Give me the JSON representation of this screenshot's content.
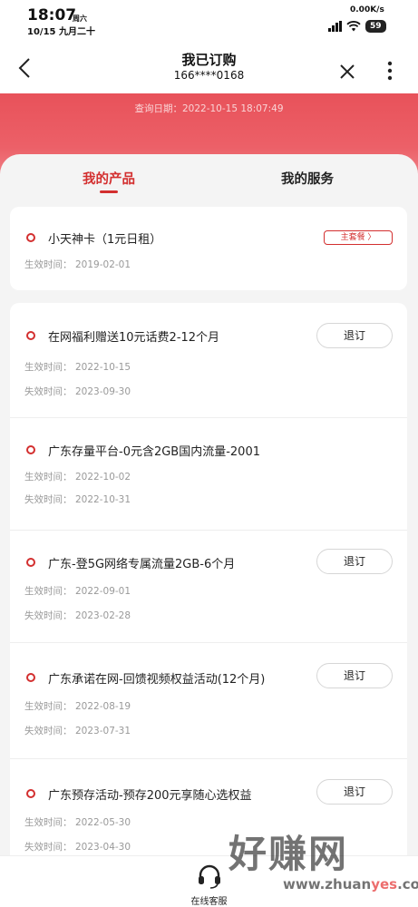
{
  "status_bar": {
    "time": "18:07",
    "weekday": "周六",
    "date": "10/15 九月二十",
    "net_speed": "0.00K/s",
    "battery": "59"
  },
  "header": {
    "title": "我已订购",
    "phone": "166****0168"
  },
  "banner": {
    "query_date": "查询日期：2022-10-15 18:07:49"
  },
  "tabs": {
    "products": "我的产品",
    "services": "我的服务"
  },
  "main_package": {
    "name": "小天神卡（1元日租）",
    "badge": "主套餐 〉",
    "effective_label": "生效时间：",
    "effective": "2019-02-01"
  },
  "labels": {
    "effective": "生效时间：",
    "expire": "失效时间：",
    "unsubscribe": "退订"
  },
  "products": [
    {
      "name": "在网福利赠送10元话费2-12个月",
      "effective": "2022-10-15",
      "expire": "2023-09-30",
      "unsubscribe": "退订"
    },
    {
      "name": "广东存量平台-0元含2GB国内流量-2001",
      "effective": "2022-10-02",
      "expire": "2022-10-31",
      "unsubscribe": ""
    },
    {
      "name": "广东-登5G网络专属流量2GB-6个月",
      "effective": "2022-09-01",
      "expire": "2023-02-28",
      "unsubscribe": "退订"
    },
    {
      "name": "广东承诺在网-回馈视频权益活动(12个月)",
      "effective": "2022-08-19",
      "expire": "2023-07-31",
      "unsubscribe": "退订"
    },
    {
      "name": "广东预存活动-预存200元享随心选权益",
      "effective": "2022-05-30",
      "expire": "2023-04-30",
      "unsubscribe": "退订"
    }
  ],
  "bottom_bar": {
    "customer_service": "在线客服"
  },
  "watermark": {
    "big": "好赚网",
    "small_1": "www.zhuan",
    "small_hl": "yes",
    "small_2": ".com"
  },
  "colors": {
    "accent": "#d32f2f",
    "banner": "#e8525a",
    "background": "#f4f4f4"
  }
}
